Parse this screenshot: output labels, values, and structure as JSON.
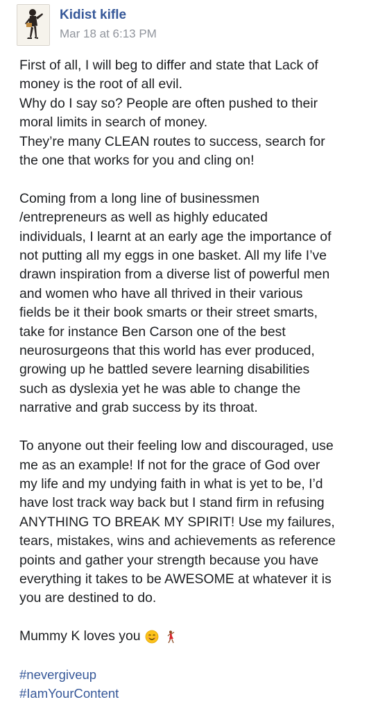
{
  "post": {
    "author": "Kidist kifle",
    "timestamp": "Mar 18 at 6:13 PM",
    "paragraph1": [
      "First of all, I will beg to differ and state that Lack of",
      "money is the root of all evil.",
      "Why do I say so? People are often pushed to their",
      "moral limits in search of money.",
      "They’re many CLEAN routes to success, search for",
      "the one that works for you and cling on!"
    ],
    "paragraph2": [
      "Coming from a long line of businessmen",
      "/entrepreneurs as well as highly educated",
      "individuals, I learnt at an early age the importance of",
      "not putting all my eggs in one basket. All my life I’ve",
      "drawn inspiration from a diverse list of powerful men",
      "and women who have all thrived in their various",
      "fields be it their book smarts or their street smarts,",
      "take for instance Ben Carson one of the best",
      "neurosurgeons that this world has ever produced,",
      "growing up he battled severe learning disabilities",
      "such as dyslexia yet he was able to change the",
      "narrative and grab success by its throat."
    ],
    "paragraph3": [
      "To anyone out their feeling low and discouraged, use",
      "me as an example! If not for the grace of God over",
      "my life and my undying faith in what is yet to be, I’d",
      "have lost track way back but I stand firm in refusing",
      "ANYTHING TO BREAK MY SPIRIT! Use my failures,",
      "tears, mistakes, wins and achievements as reference",
      "points and gather your strength because you have",
      "everything it takes to be AWESOME at whatever it is",
      "you are destined to do."
    ],
    "signoff": "Mummy K loves you",
    "signoff_emojis": [
      "smiling-face-icon",
      "dancer-icon"
    ],
    "hashtags": [
      "#nevergiveup",
      "#IamYourContent"
    ],
    "colors": {
      "link": "#365899",
      "text": "#1c1e21",
      "meta": "#90949c"
    }
  }
}
